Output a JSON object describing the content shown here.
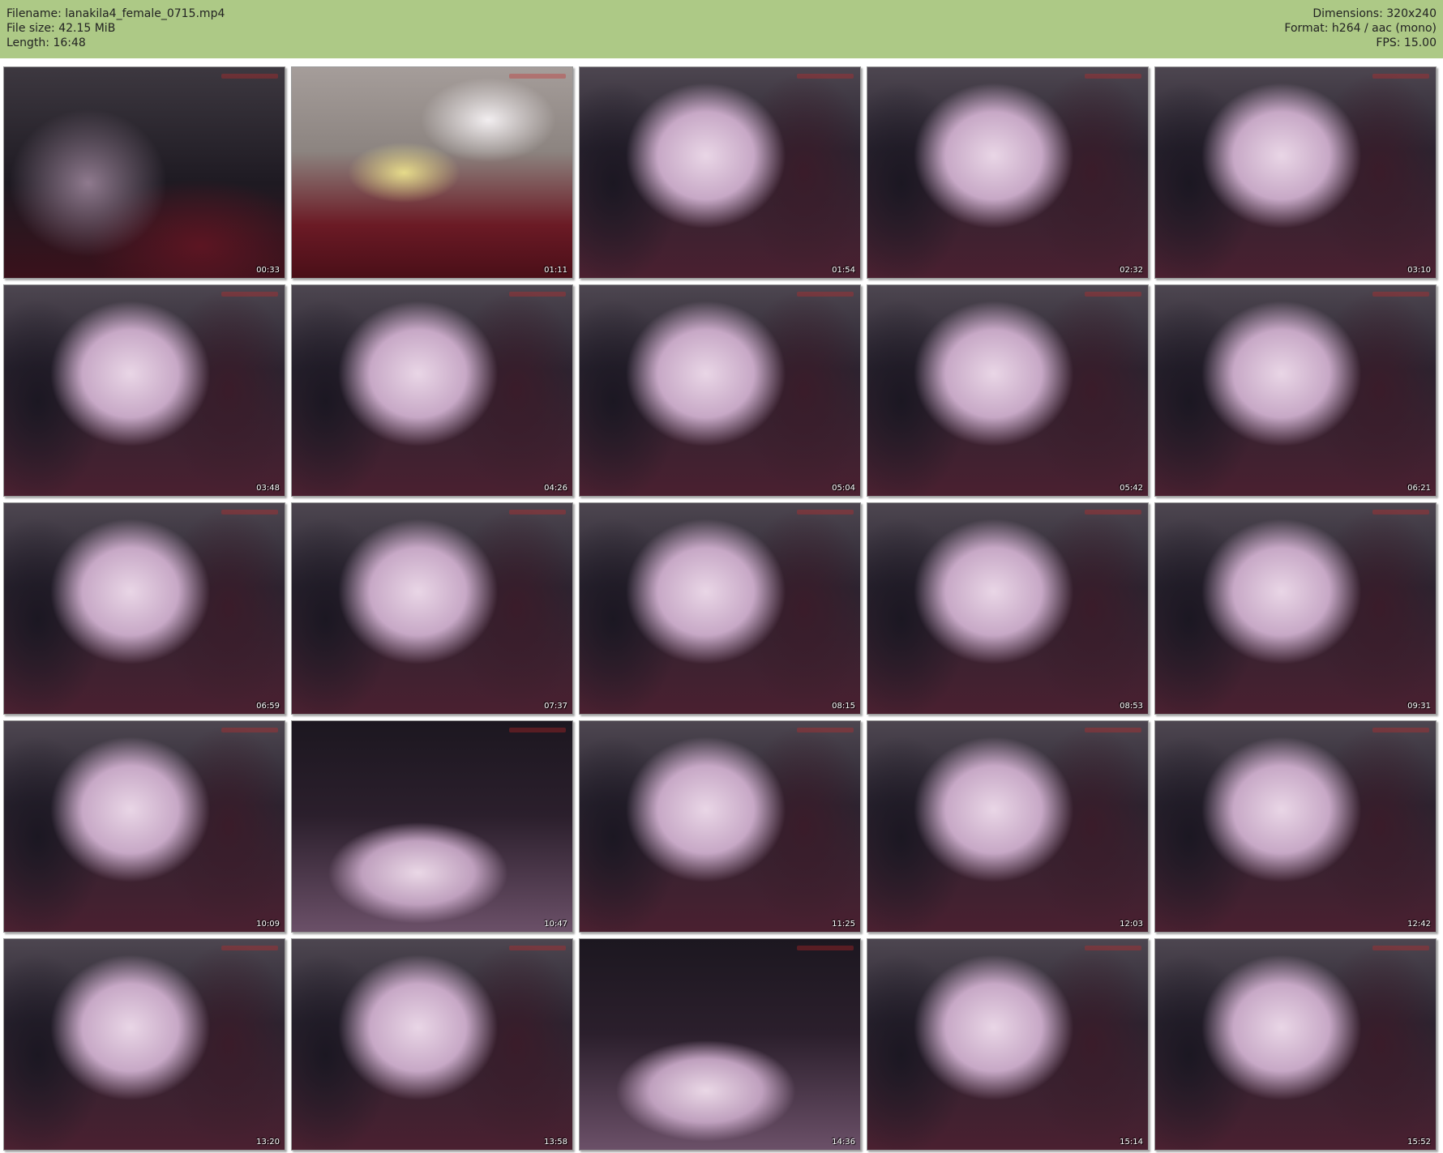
{
  "header": {
    "filename": "Filename: lanakila4_female_0715.mp4",
    "filesize": "File size: 42.15 MiB",
    "length": "Length: 16:48",
    "dimensions": "Dimensions: 320x240",
    "format": "Format: h264 / aac (mono)",
    "fps": "FPS: 15.00"
  },
  "colors": {
    "header_bg": "#adc986",
    "page_bg": "#ffffff",
    "timestamp_text": "#ffffff"
  },
  "thumbnails": [
    {
      "timestamp": "00:33",
      "scene": "dark"
    },
    {
      "timestamp": "01:11",
      "scene": "room"
    },
    {
      "timestamp": "01:54",
      "scene": "face"
    },
    {
      "timestamp": "02:32",
      "scene": "face"
    },
    {
      "timestamp": "03:10",
      "scene": "face"
    },
    {
      "timestamp": "03:48",
      "scene": "face"
    },
    {
      "timestamp": "04:26",
      "scene": "face"
    },
    {
      "timestamp": "05:04",
      "scene": "face"
    },
    {
      "timestamp": "05:42",
      "scene": "face"
    },
    {
      "timestamp": "06:21",
      "scene": "face"
    },
    {
      "timestamp": "06:59",
      "scene": "face"
    },
    {
      "timestamp": "07:37",
      "scene": "face"
    },
    {
      "timestamp": "08:15",
      "scene": "face"
    },
    {
      "timestamp": "08:53",
      "scene": "face"
    },
    {
      "timestamp": "09:31",
      "scene": "face"
    },
    {
      "timestamp": "10:09",
      "scene": "face"
    },
    {
      "timestamp": "10:47",
      "scene": "hair"
    },
    {
      "timestamp": "11:25",
      "scene": "face"
    },
    {
      "timestamp": "12:03",
      "scene": "face"
    },
    {
      "timestamp": "12:42",
      "scene": "face"
    },
    {
      "timestamp": "13:20",
      "scene": "face"
    },
    {
      "timestamp": "13:58",
      "scene": "face"
    },
    {
      "timestamp": "14:36",
      "scene": "hair"
    },
    {
      "timestamp": "15:14",
      "scene": "face"
    },
    {
      "timestamp": "15:52",
      "scene": "face"
    }
  ]
}
